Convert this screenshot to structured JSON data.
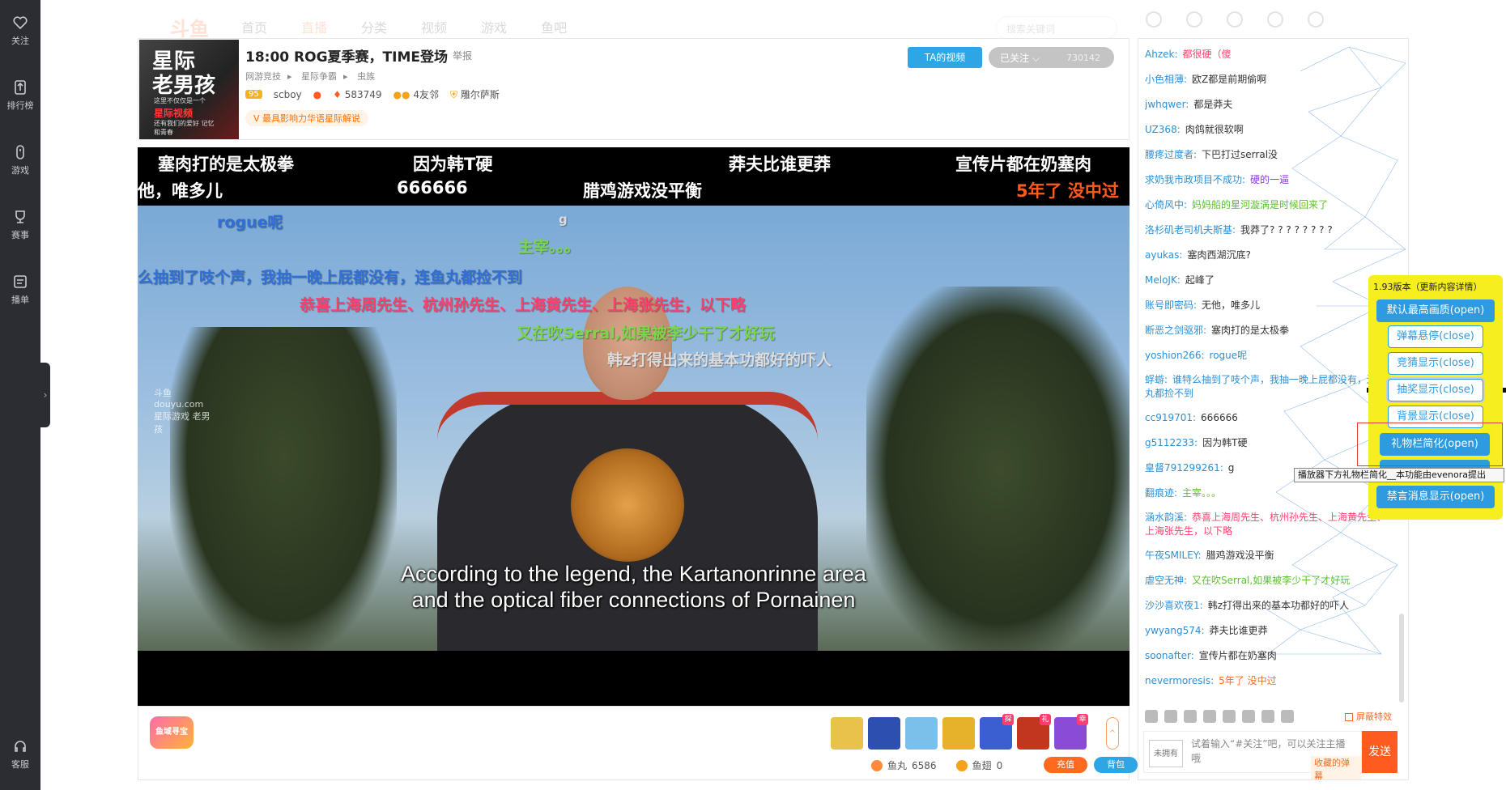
{
  "rail": {
    "items": [
      {
        "label": "关注",
        "icon": "heart-icon"
      },
      {
        "label": "排行榜",
        "icon": "ranking-icon"
      },
      {
        "label": "游戏",
        "icon": "gamepad-icon"
      },
      {
        "label": "赛事",
        "icon": "trophy-icon"
      },
      {
        "label": "播单",
        "icon": "playlist-icon"
      }
    ],
    "service": "客服"
  },
  "nav": {
    "logo": "斗鱼",
    "links": [
      "首页",
      "直播",
      "分类",
      "视频",
      "游戏",
      "鱼吧"
    ],
    "search_placeholder": "搜索关键词"
  },
  "room": {
    "cover": {
      "line1": "星际",
      "line2": "老男孩",
      "line3": "这里不仅仅是一个",
      "line4": "星际视频",
      "line5": "还有我们的爱好 记忆和青春"
    },
    "title": "18:00 ROG夏季赛，TIME登场",
    "report": "举报",
    "breadcrumbs": [
      "网游竞技",
      "星际争霸",
      "虫族"
    ],
    "level": "95",
    "anchor": "scboy",
    "hot": "583749",
    "friends": "4友邻",
    "guild": "雕尔萨斯",
    "tag": "最具影响力华语星际解说",
    "ta_video": "TA的视频",
    "follow_label": "已关注",
    "follow_count": "730142"
  },
  "player": {
    "danmaku_top": [
      {
        "text": "塞肉打的是太极拳",
        "c": "w"
      },
      {
        "text": "因为韩T硬",
        "c": "w"
      },
      {
        "text": "莽夫比谁更莽",
        "c": "w"
      },
      {
        "text": "宣传片都在奶塞肉",
        "c": "w"
      },
      {
        "text": "他，唯多儿",
        "c": "w"
      },
      {
        "text": "666666",
        "c": "w"
      },
      {
        "text": "腊鸡游戏没平衡",
        "c": "w"
      },
      {
        "text": "5年了 没中过",
        "c": "o"
      }
    ],
    "danmaku_video": [
      {
        "text": "rogue呢",
        "c": "b"
      },
      {
        "text": "g",
        "c": "gy"
      },
      {
        "text": "主宰。。。",
        "c": "g"
      },
      {
        "text": "么抽到了吱个声，我抽一晚上屁都没有，连鱼丸都捡不到",
        "c": "b"
      },
      {
        "text": "恭喜上海周先生、杭州孙先生、上海黄先生、上海张先生，以下略",
        "c": "p"
      },
      {
        "text": "又在吹Serral,如果被李少干了才好玩",
        "c": "g"
      },
      {
        "text": "韩z打得出来的基本功都好的吓人",
        "c": "gy"
      }
    ],
    "subtitle_1": "According to the legend, the Kartanonrinne area",
    "subtitle_2": "and the optical fiber connections of Pornainen",
    "watermark": "斗鱼 douyu.com 星际游戏 老男孩"
  },
  "gift_bar": {
    "treasure": "鱼域寻宝",
    "gifts": [
      {
        "name": "rocket-gift-icon",
        "color": "#e8c24a",
        "badge": ""
      },
      {
        "name": "spaceship-gift-icon",
        "color": "#2d4fb0",
        "badge": ""
      },
      {
        "name": "plane-gift-icon",
        "color": "#7ac0ea",
        "badge": ""
      },
      {
        "name": "gold-bar-gift-icon",
        "color": "#e6b22a",
        "badge": ""
      },
      {
        "name": "explore-gift-icon",
        "color": "#3b5fd0",
        "badge": "探"
      },
      {
        "name": "gift-box-gift-icon",
        "color": "#c2361f",
        "badge": "礼"
      },
      {
        "name": "lucky-gift-icon",
        "color": "#8a4bd6",
        "badge": "幸"
      }
    ],
    "fishball_label": "鱼丸",
    "fishball_count": "6586",
    "fishfin_label": "鱼翅",
    "fishfin_count": "0",
    "recharge": "充值",
    "backpack": "背包"
  },
  "chat": {
    "messages": [
      {
        "user": "Ahzek:",
        "text": "都很硬（傻",
        "color": "#ff3f6c"
      },
      {
        "user": "小色相薄:",
        "text": "欧Z都是前期偷啊",
        "color": "#333333"
      },
      {
        "user": "jwhqwer:",
        "text": "都是莽夫",
        "color": "#333333"
      },
      {
        "user": "UZ368:",
        "text": "肉鸽就很软啊",
        "color": "#333333"
      },
      {
        "user": "腰疼过度者:",
        "text": "下巴打过serral没",
        "color": "#333333"
      },
      {
        "user": "求奶我市政项目不成功:",
        "text": "硬的一逼",
        "color": "#8a3fd6"
      },
      {
        "user": "心倚风中:",
        "text": "妈妈船的星河漩涡是时候回来了",
        "color": "#5bbf2a"
      },
      {
        "user": "洛杉矶老司机夫斯基:",
        "text": "我莽了? ? ? ? ? ? ? ?",
        "color": "#333333"
      },
      {
        "user": "ayukas:",
        "text": "塞肉西湖沉底?",
        "color": "#333333"
      },
      {
        "user": "MeloJK:",
        "text": "起峰了",
        "color": "#333333"
      },
      {
        "user": "账号即密码:",
        "text": "无他，唯多儿",
        "color": "#333333"
      },
      {
        "user": "断恶之剑驱邪:",
        "text": "塞肉打的是太极拳",
        "color": "#333333"
      },
      {
        "user": "yoshion266:",
        "text": "rogue呢",
        "color": "#2d8fd5"
      },
      {
        "user": "蜉蝣:",
        "text": "谁特么抽到了吱个声，我抽一晚上屁都没有，连鱼丸都捡不到",
        "color": "#2d8fd5",
        "wrap": true
      },
      {
        "user": "cc919701:",
        "text": "666666",
        "color": "#333333"
      },
      {
        "user": "g5112233:",
        "text": "因为韩T硬",
        "color": "#333333"
      },
      {
        "user": "皇督791299261:",
        "text": "g",
        "color": "#333333"
      },
      {
        "user": "翻痕迹:",
        "text": "主宰。。。",
        "color": "#5bbf2a"
      },
      {
        "user": "涵水韵溪:",
        "text": "恭喜上海周先生、杭州孙先生、上海黄先生、上海张先生，以下略",
        "color": "#ff3f6c",
        "wrap": true
      },
      {
        "user": "午夜SMILEY:",
        "text": "腊鸡游戏没平衡",
        "color": "#333333"
      },
      {
        "user": "虐空无神:",
        "text": "又在吹Serral,如果被李少干了才好玩",
        "color": "#5bbf2a"
      },
      {
        "user": "沙沙喜欢夜1:",
        "text": "韩z打得出来的基本功都好的吓人",
        "color": "#333333"
      },
      {
        "user": "ywyang574:",
        "text": "莽夫比谁更莽",
        "color": "#333333"
      },
      {
        "user": "soonafter:",
        "text": "宣传片都在奶塞肉",
        "color": "#333333"
      },
      {
        "user": "nevermoresis:",
        "text": "5年了 没中过",
        "color": "#ff6a1f"
      }
    ],
    "shield_fx": "屏蔽特效",
    "fan_badge": "未拥有",
    "input_placeholder": "试着输入“#关注”吧，可以关注主播哦",
    "fav_danmaku": "收藏的弹幕",
    "send": "发送"
  },
  "plugin": {
    "version": "1.93版本（更新内容详情）",
    "buttons": [
      {
        "label": "默认最高画质(open)",
        "style": "solid"
      },
      {
        "label": "弹幕悬停(close)",
        "style": "outline"
      },
      {
        "label": "竞猜显示(close)",
        "style": "outline"
      },
      {
        "label": "抽奖显示(close)",
        "style": "outline"
      },
      {
        "label": "背景显示(close)",
        "style": "outline"
      },
      {
        "label": "礼物栏简化(open)",
        "style": "solid"
      },
      {
        "label": "",
        "style": "solid"
      },
      {
        "label": "禁言消息显示(open)",
        "style": "solid"
      }
    ],
    "tooltip": "播放器下方礼物栏简化__本功能由evenora提出"
  }
}
